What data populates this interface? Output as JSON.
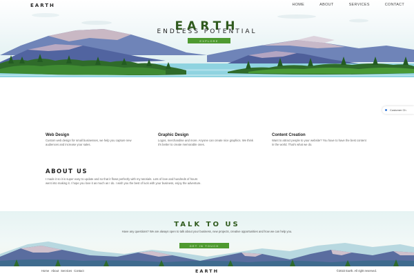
{
  "header": {
    "logo": "EARTH",
    "nav": [
      "HOME",
      "ABOUT",
      "SERVICES",
      "CONTACT"
    ]
  },
  "hero": {
    "title": "EARTH",
    "subtitle": "ENDLESS POTENTIAL",
    "cta": "EXPLORE"
  },
  "chat": {
    "label": "Customer Ch",
    "icon": "chat-icon"
  },
  "services": [
    {
      "title": "Web Design",
      "text": "Custom web design for small businesses, we help you capture new audiences and increase your sales."
    },
    {
      "title": "Graphic Design",
      "text": "Logos, merchandise and more. Anyone can create nice graphics. We think it's better to create memorable ones."
    },
    {
      "title": "Content Creation",
      "text": "Want to attract people to your website? You have to have the best content in the world. That's what we do."
    }
  ],
  "about": {
    "heading": "ABOUT US",
    "text": "I made it so it is super easy to update and so that it flows perfectly with my tutorials. Lots of love and hundreds of hours went into making it. I hope you love it as much as I do. I wish you the best of luck with your business, enjoy the adventure."
  },
  "talk": {
    "heading": "TALK TO US",
    "text": "Have any questions? We are always open to talk about your business, new projects, creative opportunities and how we can help you.",
    "cta": "GET IN TOUCH"
  },
  "footer": {
    "links": [
      "Home",
      "About",
      "Services",
      "Contact"
    ],
    "logo": "EARTH",
    "copyright": "©2022 Earth. All right reserved."
  },
  "colors": {
    "accent_green": "#4e9a30",
    "title_green": "#2f5a1d",
    "lake": "#8fd3e0"
  }
}
